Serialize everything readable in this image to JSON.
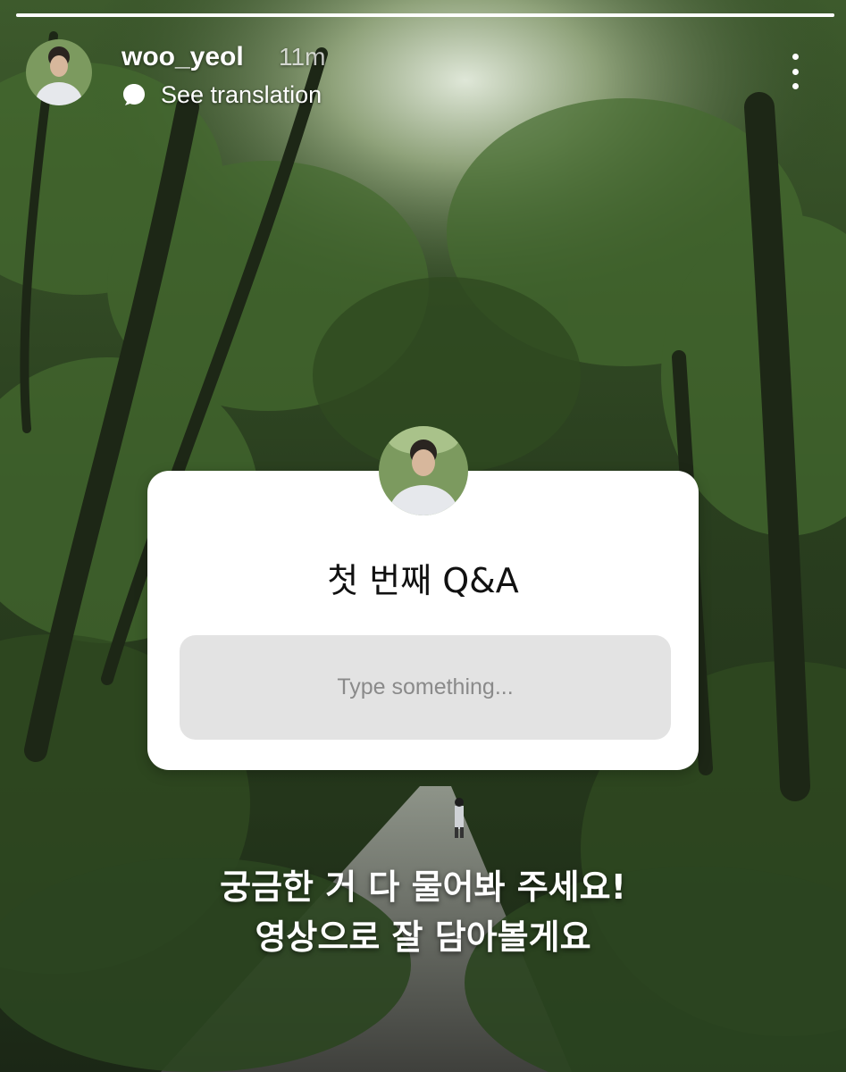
{
  "story": {
    "progress": 1.0,
    "username": "woo_yeol",
    "time": "11m",
    "translate_label": "See translation"
  },
  "sticker": {
    "title": "첫 번째 Q&A",
    "input_placeholder": "Type something..."
  },
  "caption": {
    "line1": "궁금한 거 다 물어봐 주세요!",
    "line2": "영상으로 잘 담아볼게요"
  },
  "icons": {
    "translate": "speech-bubble-icon",
    "more": "more-vertical-icon"
  },
  "colors": {
    "sticker_bg": "#ffffff",
    "input_bg": "#e3e3e3",
    "text_light": "#ffffff"
  }
}
